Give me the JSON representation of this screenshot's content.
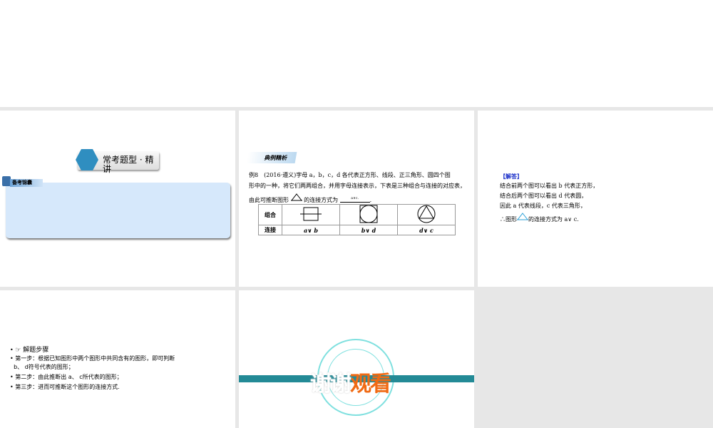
{
  "slide1": {
    "title": "常考题型 · 精讲",
    "tag": "备考锦囊"
  },
  "slide2": {
    "tag": "典例精析",
    "line1": "例8　(2016·遵义)字母 a，b，c，d 各代表正方形、线段、正三角形、圆四个图",
    "line2": "形中的一种，将它们两两组合，并用字母连接表示，下表是三种组合与连接的对应表，",
    "line3_pre": "由此可推断图形",
    "line3_post": "的连接方式为",
    "blank_answer": "a∨c.",
    "line3_end": ".",
    "table": {
      "row_headers": [
        "组合",
        "连接"
      ],
      "connections": [
        "a∨ b",
        "b∨ d",
        "d∨ c"
      ]
    }
  },
  "slide3": {
    "heading": "【解答】",
    "lines": [
      "结合前两个图可以看出 b 代表正方形，",
      "结合后两个图可以看出 d 代表圆，",
      "因此 a 代表线段，c 代表三角形，"
    ],
    "last_pre": "∴图形",
    "last_post": "的连接方式为 a∨ c."
  },
  "slide4": {
    "steps": [
      "☞ 解题步骤",
      "第一步：根据已知图形中两个图形中共同含有的图形，即可判断",
      "b、 d符号代表的图形；",
      "第二步：由此推断出 a、 c所代表的图形；",
      "第三步：进而可推断这个图形的连接方式."
    ]
  },
  "slide5": {
    "thanks_white": "谢谢",
    "thanks_orange": "观看"
  },
  "colors": {
    "accent": "#238a96",
    "orange": "#f06a14",
    "blue_box": "#d6e8fb"
  }
}
